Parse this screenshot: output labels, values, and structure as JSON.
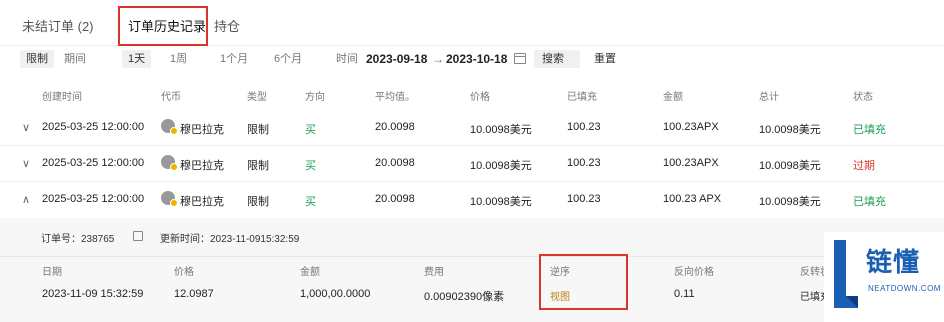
{
  "tabs": [
    {
      "label": "未结订单 (2)"
    },
    {
      "label": "订单历史记录"
    },
    {
      "label": "持仓"
    }
  ],
  "filter": {
    "type_label": "限制",
    "period_label": "期间",
    "ranges": [
      "1天",
      "1周",
      "1个月",
      "6个月"
    ],
    "time_label": "时间",
    "date_start": "2023-09-18",
    "date_arrow": "→",
    "date_end": "2023-10-18",
    "search_label": "搜索",
    "reset_label": "重置"
  },
  "columns": [
    "创建时间",
    "代币",
    "类型",
    "方向",
    "平均值。",
    "价格",
    "已填充",
    "金额",
    "总计",
    "状态"
  ],
  "orders": [
    {
      "chevron": "∨",
      "time": "2025-03-25 12:00:00",
      "coin": "穆巴拉克",
      "type": "限制",
      "side": "买",
      "avg": "20.0098",
      "price": "10.0098美元",
      "filled": "100.23",
      "amount": "100.23APX",
      "total": "10.0098美元",
      "status": "已填充"
    },
    {
      "chevron": "∨",
      "time": "2025-03-25 12:00:00",
      "coin": "穆巴拉克",
      "type": "限制",
      "side": "买",
      "avg": "20.0098",
      "price": "10.0098美元",
      "filled": "100.23",
      "amount": "100.23APX",
      "total": "10.0098美元",
      "status": "过期"
    },
    {
      "chevron": "∧",
      "time": "2025-03-25 12:00:00",
      "coin": "穆巴拉克",
      "type": "限制",
      "side": "买",
      "avg": "20.0098",
      "price": "10.0098美元",
      "filled": "100.23",
      "amount": "100.23 APX",
      "total": "10.0098美元",
      "status": "已填充"
    }
  ],
  "detail": {
    "order_no_label": "订单号：238765",
    "update_label": "更新时间：2023-11-0915:32:59",
    "columns": [
      "日期",
      "价格",
      "金额",
      "费用",
      "逆序",
      "反向价格",
      "反转状态"
    ],
    "row": {
      "date": "2023-11-09 15:32:59",
      "price": "12.0987",
      "amount": "1,000,00.0000",
      "fee": "0.00902390像素",
      "reverse": "视图",
      "reverse_price": "0.11",
      "reverse_status": "已填充"
    }
  },
  "logo": {
    "text": "链懂",
    "sub": "NEATDOWN.COM"
  },
  "colors": {
    "buy": "#1a9e55",
    "expired": "#d9362b",
    "highlight": "#d9362b",
    "brand": "#1a5fb4"
  }
}
